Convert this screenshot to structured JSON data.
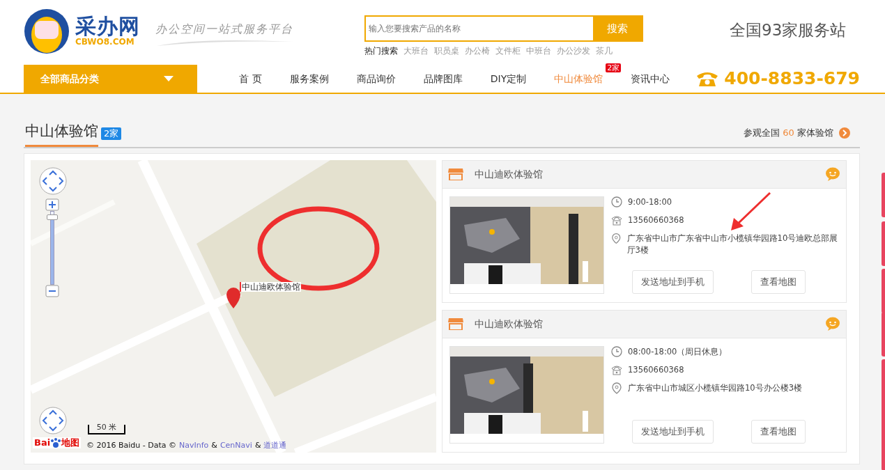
{
  "header": {
    "brand": {
      "name": "采办网",
      "domain": "CBWO8.COM"
    },
    "slogan": "办公空间一站式服务平台",
    "search": {
      "placeholder": "输入您要搜索产品的名称",
      "button": "搜索"
    },
    "hot_search": {
      "label": "热门搜索",
      "terms": [
        "大班台",
        "职员桌",
        "办公椅",
        "文件柜",
        "中班台",
        "办公沙发",
        "茶几"
      ]
    },
    "stations": "全国93家服务站"
  },
  "nav": {
    "category_button": "全部商品分类",
    "items": [
      {
        "label": "首 页",
        "selected": false
      },
      {
        "label": "服务案例",
        "selected": false
      },
      {
        "label": "商品询价",
        "selected": false
      },
      {
        "label": "品牌图库",
        "selected": false
      },
      {
        "label": "DIY定制",
        "selected": false
      },
      {
        "label": "中山体验馆",
        "selected": true,
        "badge": "2家"
      },
      {
        "label": "资讯中心",
        "selected": false
      }
    ],
    "phone": "400-8833-679"
  },
  "section": {
    "title": "中山体验馆",
    "count_badge": "2家",
    "link": {
      "prefix": "参观全国",
      "count": "60",
      "suffix": "家体验馆"
    }
  },
  "map": {
    "kind": "picture",
    "marker_label": "中山迪欧体验馆",
    "zoom": {
      "level": 0.95
    },
    "scale": "50 米",
    "logo": {
      "left": "Bai",
      "right": "地图"
    },
    "attribution": [
      {
        "kind": "text",
        "text": "© 2016 Baidu - Data ©"
      },
      {
        "kind": "link",
        "text": "NavInfo"
      },
      {
        "kind": "text",
        "text": "&"
      },
      {
        "kind": "link",
        "text": "CenNavi"
      },
      {
        "kind": "text",
        "text": "&"
      },
      {
        "kind": "link",
        "text": "道道通"
      }
    ]
  },
  "stores": [
    {
      "name": "中山迪欧体验馆",
      "hours": "9:00-18:00",
      "phone": "13560660368",
      "address": "广东省中山市广东省中山市小榄镇华园路10号迪欧总部展厅3楼",
      "buttons": [
        "发送地址到手机",
        "查看地图"
      ],
      "annotated": true
    },
    {
      "name": "中山迪欧体验馆",
      "hours": "08:00-18:00（周日休息）",
      "phone": "13560660368",
      "address": "广东省中山市城区小榄镇华园路10号办公楼3楼",
      "buttons": [
        "发送地址到手机",
        "查看地图"
      ],
      "annotated": false
    }
  ]
}
